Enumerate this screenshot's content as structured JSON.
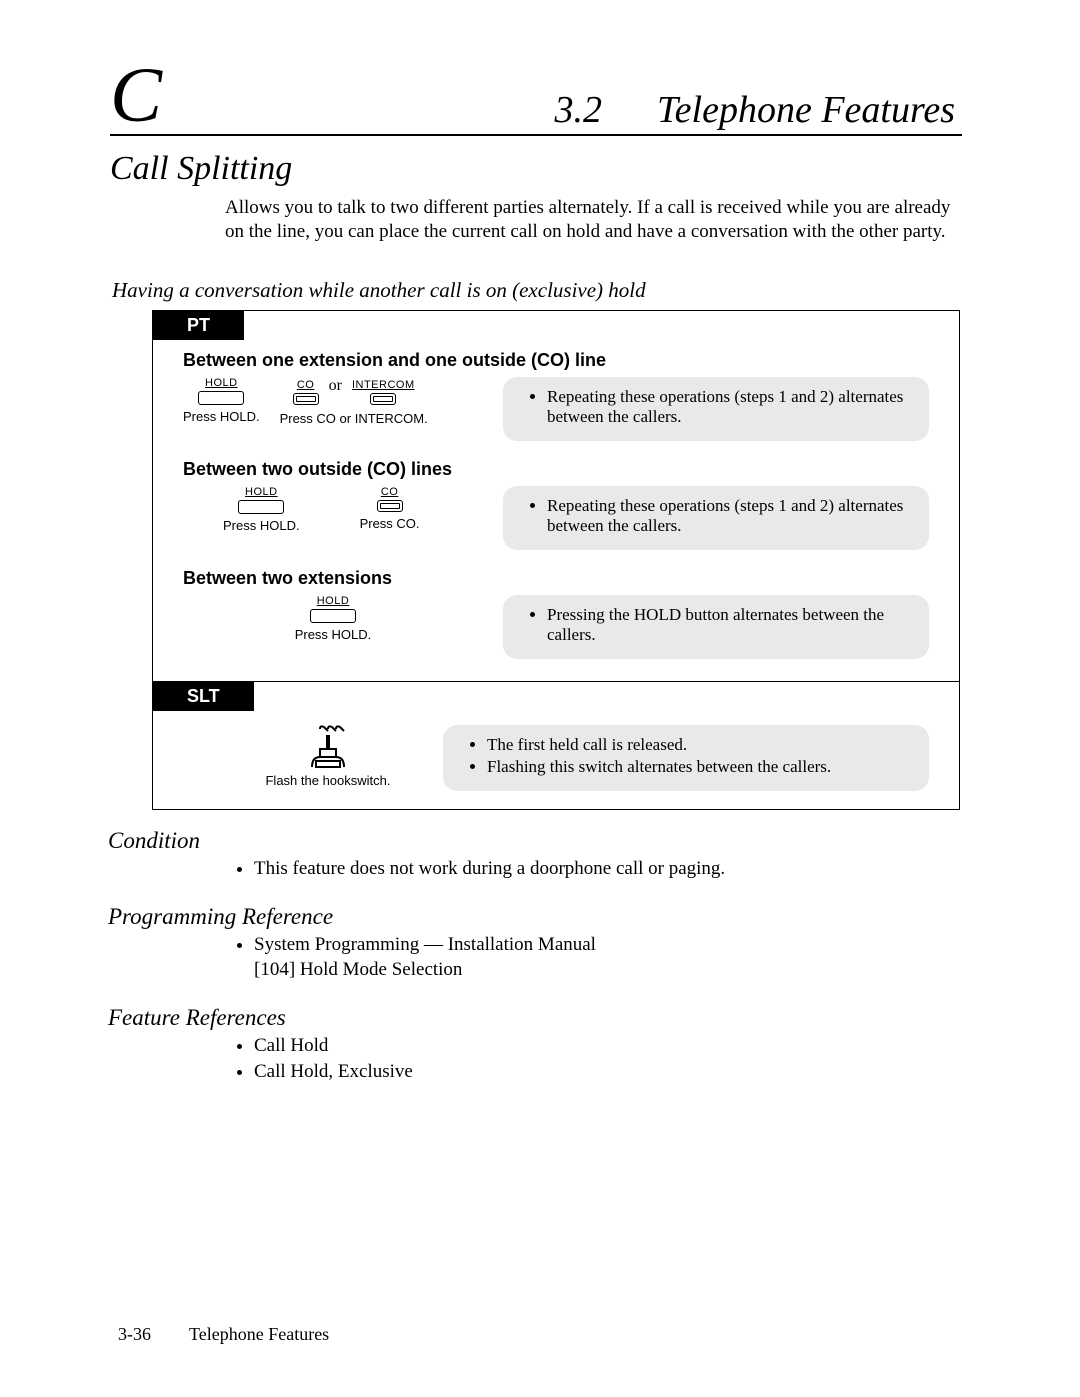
{
  "header": {
    "chapter_letter": "C",
    "section_number": "3.2",
    "section_title": "Telephone Features"
  },
  "title": "Call Splitting",
  "intro": "Allows you to talk to two different parties alternately. If a call is received while you are already on the line, you can place the current call on hold and have a conversation with the other party.",
  "subhead": "Having a conversation while another call is on (exclusive) hold",
  "pt": {
    "tab": "PT",
    "groups": [
      {
        "title": "Between one extension and one outside (CO) line",
        "step1_label": "HOLD",
        "step1_press": "Press HOLD.",
        "or": "or",
        "step2a_label": "CO",
        "step2b_label": "INTERCOM",
        "step2_press": "Press CO or INTERCOM.",
        "note": "Repeating these operations (steps 1 and 2) alternates between the callers."
      },
      {
        "title": "Between two outside (CO) lines",
        "step1_label": "HOLD",
        "step1_press": "Press HOLD.",
        "step2_label": "CO",
        "step2_press": "Press CO.",
        "note": "Repeating these operations (steps 1 and 2) alternates between the callers."
      },
      {
        "title": "Between two extensions",
        "step1_label": "HOLD",
        "step1_press": "Press HOLD.",
        "note": "Pressing the HOLD button alternates between the callers."
      }
    ]
  },
  "slt": {
    "tab": "SLT",
    "action": "Flash the hookswitch.",
    "notes": [
      "The first held call is released.",
      "Flashing this switch alternates between the callers."
    ]
  },
  "condition": {
    "head": "Condition",
    "items": [
      "This feature does not work during a doorphone call or paging."
    ]
  },
  "programming": {
    "head": "Programming Reference",
    "item": "System Programming — Installation Manual",
    "sub": "[104]  Hold Mode Selection"
  },
  "feature_refs": {
    "head": "Feature References",
    "items": [
      "Call Hold",
      "Call Hold, Exclusive"
    ]
  },
  "footer": {
    "page": "3-36",
    "label": "Telephone Features"
  }
}
